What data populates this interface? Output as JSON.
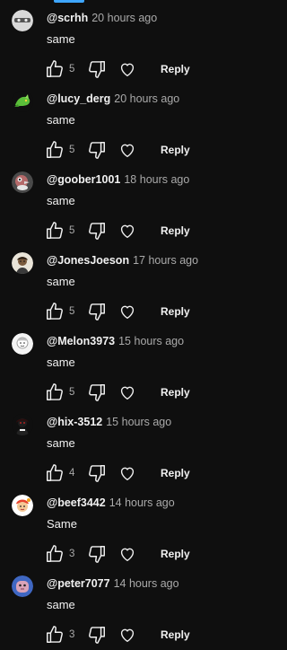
{
  "colors": {
    "background": "#0f0f0f",
    "text": "#f1f1f1",
    "muted": "#aaaaaa",
    "accent": "#3ea6ff"
  },
  "actions": {
    "reply_label": "Reply"
  },
  "comments": [
    {
      "author": "@scrhh",
      "time": "20 hours ago",
      "text": "same",
      "likes": "5",
      "avatar_icon": "avatar-grey-face-icon"
    },
    {
      "author": "@lucy_derg",
      "time": "20 hours ago",
      "text": "same",
      "likes": "5",
      "avatar_icon": "avatar-green-dragon-icon"
    },
    {
      "author": "@goober1001",
      "time": "18 hours ago",
      "text": "same",
      "likes": "5",
      "avatar_icon": "avatar-bird-icon"
    },
    {
      "author": "@JonesJoeson",
      "time": "17 hours ago",
      "text": "same",
      "likes": "5",
      "avatar_icon": "avatar-portrait-icon"
    },
    {
      "author": "@Melon3973",
      "time": "15 hours ago",
      "text": "same",
      "likes": "5",
      "avatar_icon": "avatar-white-character-icon"
    },
    {
      "author": "@hix-3512",
      "time": "15 hours ago",
      "text": "same",
      "likes": "4",
      "avatar_icon": "avatar-dark-character-icon"
    },
    {
      "author": "@beef3442",
      "time": "14 hours ago",
      "text": "Same",
      "likes": "3",
      "avatar_icon": "avatar-cartoon-icon"
    },
    {
      "author": "@peter7077",
      "time": "14 hours ago",
      "text": "same",
      "likes": "3",
      "avatar_icon": "avatar-pink-blob-icon"
    }
  ]
}
